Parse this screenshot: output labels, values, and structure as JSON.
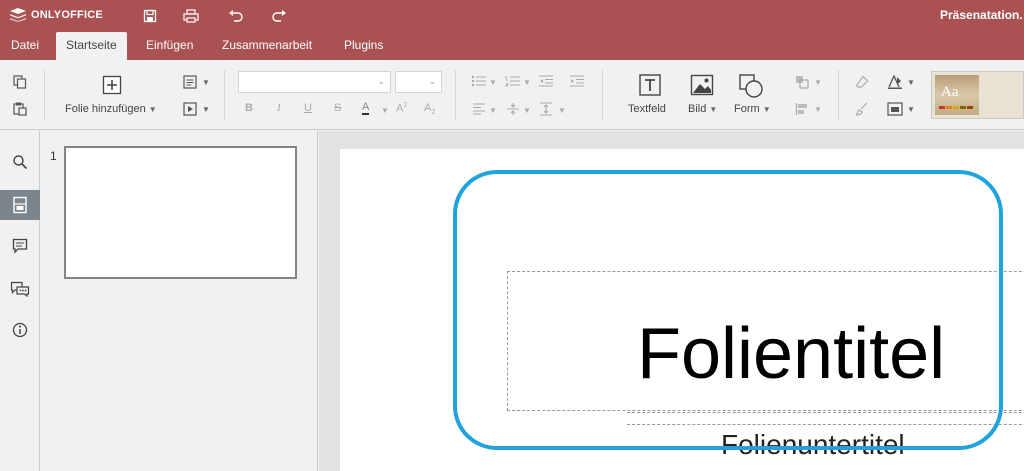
{
  "app": {
    "logo_text": "ONLYOFFICE",
    "document_title": "Präsenatation.",
    "brand_color": "#aa5252",
    "accent_color": "#1fa3dd"
  },
  "titlebar_icons": [
    "save-icon",
    "print-icon",
    "undo-icon",
    "redo-icon"
  ],
  "menu_tabs": [
    {
      "label": "Datei",
      "active": false
    },
    {
      "label": "Startseite",
      "active": true
    },
    {
      "label": "Einfügen",
      "active": false
    },
    {
      "label": "Zusammenarbeit",
      "active": false
    },
    {
      "label": "Plugins",
      "active": false
    }
  ],
  "toolbar": {
    "add_slide_label": "Folie hinzufügen",
    "textbox_label": "Textfeld",
    "image_label": "Bild",
    "shape_label": "Form",
    "font_name": "",
    "font_size": "",
    "theme_sample": "Aa"
  },
  "rail_icons": [
    "search-icon",
    "slides-icon",
    "comments-icon",
    "chat-icon",
    "info-icon"
  ],
  "thumbnails": [
    {
      "number": "1"
    }
  ],
  "slide": {
    "title": "Folientitel",
    "subtitle": "Folienuntertitel"
  }
}
